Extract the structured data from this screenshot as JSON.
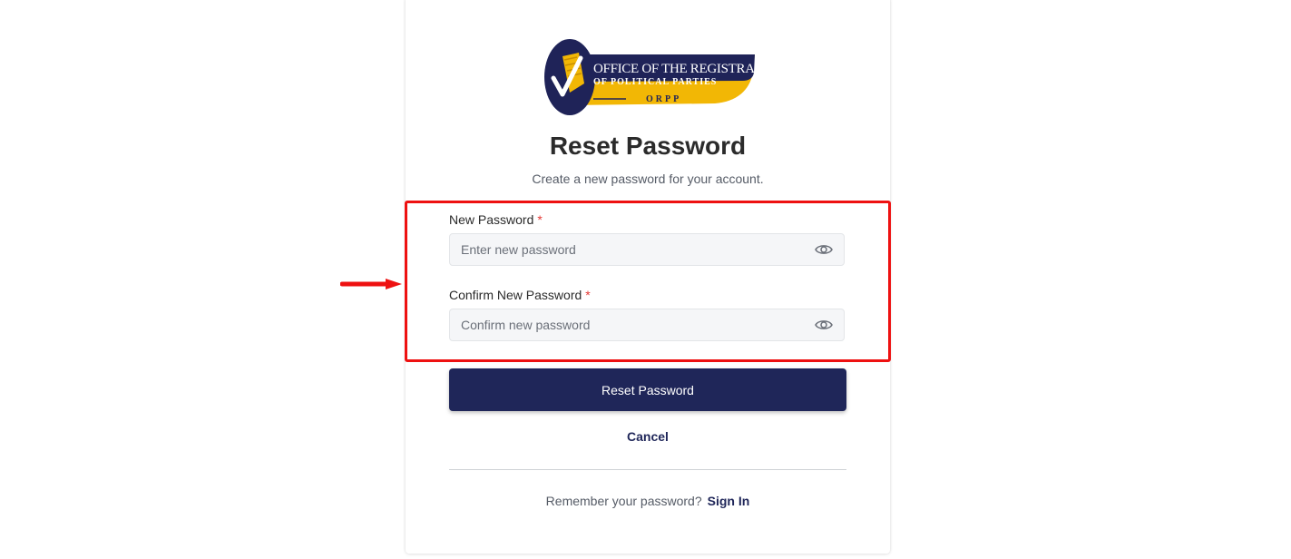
{
  "logo": {
    "line1": "OFFICE OF THE REGISTRAR",
    "line2": "OF POLITICAL PARTIES",
    "line3": "ORPP",
    "colors": {
      "navy": "#1f2358",
      "gold": "#f2b705"
    }
  },
  "page": {
    "title": "Reset Password",
    "subtitle": "Create a new password for your account."
  },
  "form": {
    "new_password": {
      "label": "New Password",
      "required": "*",
      "placeholder": "Enter new password",
      "value": "",
      "icon": "eye-icon"
    },
    "confirm_password": {
      "label": "Confirm New Password",
      "required": "*",
      "placeholder": "Confirm new password",
      "value": "",
      "icon": "eye-icon"
    },
    "submit_label": "Reset Password",
    "cancel_label": "Cancel"
  },
  "footer": {
    "prompt": "Remember your password?",
    "link_label": "Sign In"
  },
  "annotation": {
    "highlight_color": "#ee1111",
    "arrow_icon": "arrow-right-icon"
  },
  "colors": {
    "primary": "#1f2659",
    "required": "#e53935",
    "input_bg": "#f5f6f8"
  }
}
